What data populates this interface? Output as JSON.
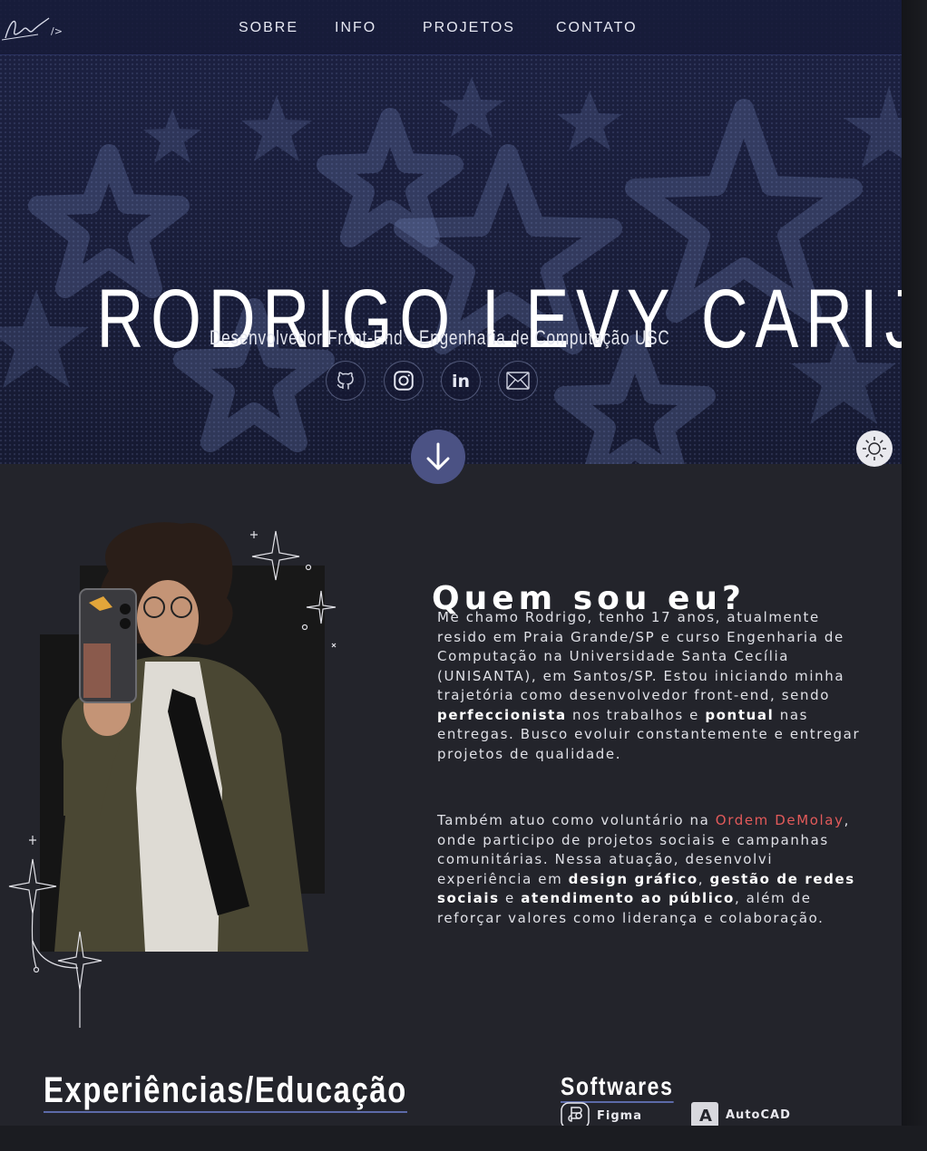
{
  "nav": {
    "items": [
      {
        "label": "SOBRE"
      },
      {
        "label": "INFO"
      },
      {
        "label": "PROJETOS"
      },
      {
        "label": "CONTATO"
      }
    ]
  },
  "hero": {
    "name": "RODRIGO LEVY CARIJÓ",
    "subtitle": "Desenvolvedor Front-End - Engenharia de Computação USC",
    "social_icons": [
      "github-icon",
      "instagram-icon",
      "linkedin-icon",
      "mail-icon"
    ]
  },
  "about": {
    "title": "Quem sou eu?",
    "p1_a": "Me chamo Rodrigo, tenho 17 anos, atualmente resido em Praia Grande/SP e curso Engenharia de Computação na Universidade Santa Cecília (UNISANTA), em Santos/SP. Estou iniciando minha trajetória como desenvolvedor front-end, sendo ",
    "p1_b": "perfeccionista",
    "p1_c": " nos trabalhos e ",
    "p1_d": "pontual",
    "p1_e": " nas entregas. Busco evoluir constantemente e entregar projetos de qualidade.",
    "p2_a": "Também atuo como voluntário na ",
    "p2_b": "Ordem DeMolay",
    "p2_c": ", onde participo de projetos sociais e campanhas comunitárias. Nessa atuação, desenvolvi experiência em ",
    "p2_d": "design gráfico",
    "p2_e": ", ",
    "p2_f": "gestão de redes sociais",
    "p2_g": " e ",
    "p2_h": "atendimento ao público",
    "p2_i": ", além de reforçar valores como liderança e colaboração."
  },
  "experience": {
    "title": "Experiências/Educação"
  },
  "software": {
    "title": "Softwares",
    "items": [
      {
        "label": "Figma",
        "icon": "figma-icon"
      },
      {
        "label": "AutoCAD",
        "icon": "autocad-icon"
      }
    ]
  },
  "colors": {
    "accent": "#e25a5a",
    "hero_bg": "#1a1e3b",
    "page_bg": "#23242b",
    "button": "#4b5284"
  }
}
